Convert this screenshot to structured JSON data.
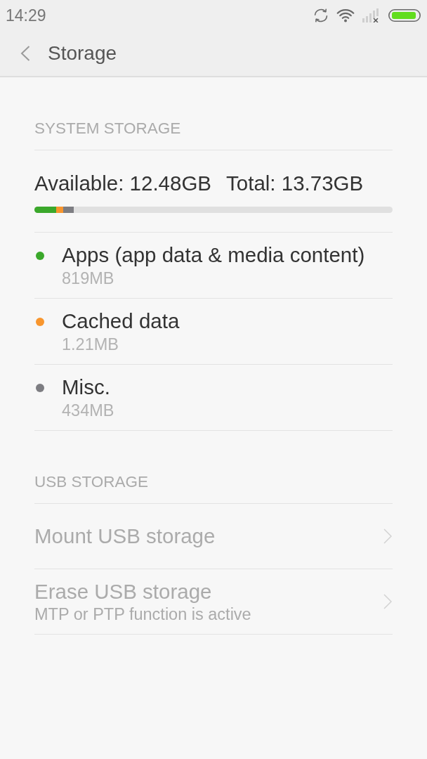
{
  "status_bar": {
    "time": "14:29"
  },
  "header": {
    "title": "Storage"
  },
  "system_storage": {
    "heading": "SYSTEM STORAGE",
    "available": "Available: 12.48GB",
    "total": "Total: 13.73GB",
    "categories": [
      {
        "name": "Apps (app data & media content)",
        "size": "819MB",
        "color": "#3ba82b",
        "level": 0.06
      },
      {
        "name": "Cached data",
        "size": "1.21MB",
        "color": "#f8962e",
        "level": 0.02
      },
      {
        "name": "Misc.",
        "size": "434MB",
        "color": "#7d7d82",
        "level": 0.03
      }
    ]
  },
  "usb_storage": {
    "heading": "USB STORAGE",
    "items": [
      {
        "title": "Mount USB storage",
        "disabled": true
      },
      {
        "title": "Erase USB storage",
        "subtitle": "MTP or PTP function is active",
        "disabled": true
      }
    ]
  }
}
